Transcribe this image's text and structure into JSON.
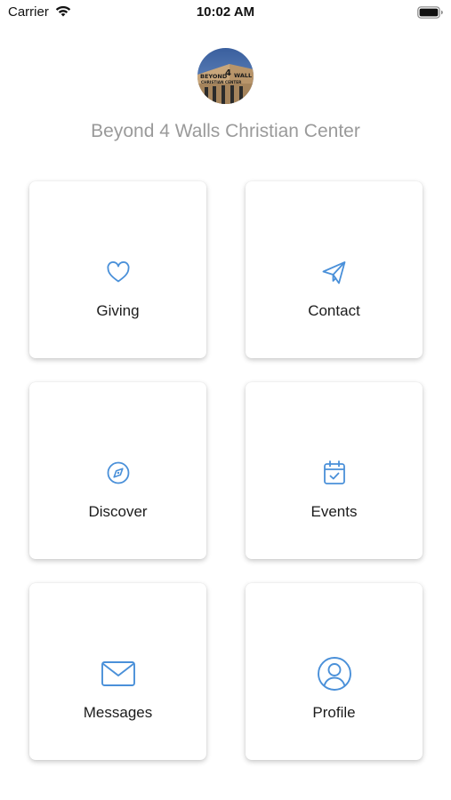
{
  "status_bar": {
    "carrier": "Carrier",
    "time": "10:02 AM"
  },
  "header": {
    "org_name": "Beyond 4 Walls Christian Center",
    "avatar_text_line1": "BEYOND 4 WALLS",
    "avatar_text_line2": "CHRISTIAN CENTER"
  },
  "colors": {
    "icon_blue": "#4a90d9",
    "label": "#1c1c1c",
    "org_name": "#9a9a9a"
  },
  "tiles": [
    {
      "label": "Giving",
      "icon": "heart-icon"
    },
    {
      "label": "Contact",
      "icon": "paper-plane-icon"
    },
    {
      "label": "Discover",
      "icon": "compass-icon"
    },
    {
      "label": "Events",
      "icon": "calendar-check-icon"
    },
    {
      "label": "Messages",
      "icon": "envelope-icon"
    },
    {
      "label": "Profile",
      "icon": "user-circle-icon"
    }
  ]
}
